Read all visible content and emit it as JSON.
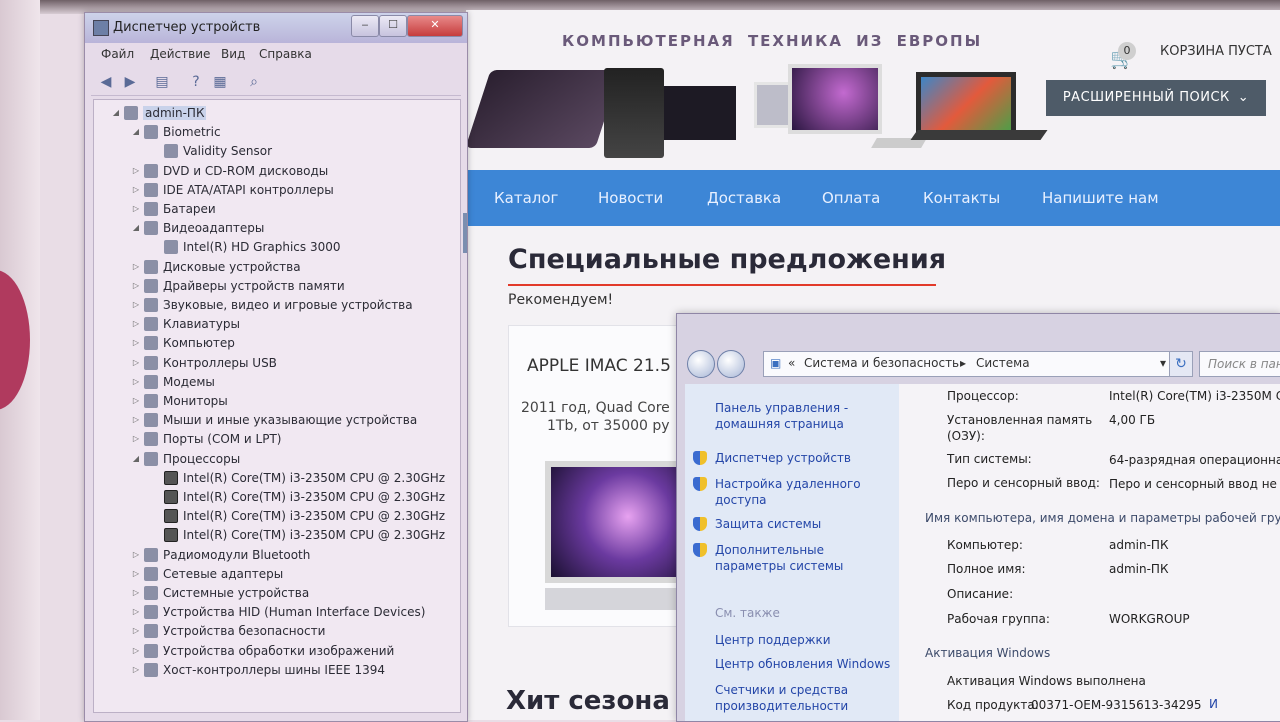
{
  "site": {
    "tagline": "КОМПЬЮТЕРНАЯ ТЕХНИКА ИЗ ЕВРОПЫ",
    "cart_count": "0",
    "cart_label": "КОРЗИНА ПУСТА",
    "advanced_search": "РАСШИРЕННЫЙ ПОИСК",
    "nav": [
      "Каталог",
      "Новости",
      "Доставка",
      "Оплата",
      "Контакты",
      "Напишите нам"
    ],
    "special_title": "Специальные предложения",
    "recommend": "Рекомендуем!",
    "product_name": "APPLE IMAC 21.5",
    "product_desc_line1": "2011 год, Quad Core",
    "product_desc_line2": "1Tb, от 35000 ру",
    "hit_title": "Хит сезона"
  },
  "device_manager": {
    "title": "Диспетчер устройств",
    "window_buttons": [
      "‒",
      "☐",
      "✕"
    ],
    "menu": [
      "Файл",
      "Действие",
      "Вид",
      "Справка"
    ],
    "tree": [
      {
        "label": "admin-ПК",
        "level": 0,
        "expander": "◢"
      },
      {
        "label": "Biometric",
        "level": 1,
        "expander": "◢"
      },
      {
        "label": "Validity Sensor",
        "level": 2,
        "expander": ""
      },
      {
        "label": "DVD и CD-ROM дисководы",
        "level": 1,
        "expander": "▷"
      },
      {
        "label": "IDE ATA/ATAPI контроллеры",
        "level": 1,
        "expander": "▷"
      },
      {
        "label": "Батареи",
        "level": 1,
        "expander": "▷"
      },
      {
        "label": "Видеоадаптеры",
        "level": 1,
        "expander": "◢"
      },
      {
        "label": "Intel(R) HD Graphics 3000",
        "level": 2,
        "expander": ""
      },
      {
        "label": "Дисковые устройства",
        "level": 1,
        "expander": "▷"
      },
      {
        "label": "Драйверы устройств памяти",
        "level": 1,
        "expander": "▷"
      },
      {
        "label": "Звуковые, видео и игровые устройства",
        "level": 1,
        "expander": "▷"
      },
      {
        "label": "Клавиатуры",
        "level": 1,
        "expander": "▷"
      },
      {
        "label": "Компьютер",
        "level": 1,
        "expander": "▷"
      },
      {
        "label": "Контроллеры USB",
        "level": 1,
        "expander": "▷"
      },
      {
        "label": "Модемы",
        "level": 1,
        "expander": "▷"
      },
      {
        "label": "Мониторы",
        "level": 1,
        "expander": "▷"
      },
      {
        "label": "Мыши и иные указывающие устройства",
        "level": 1,
        "expander": "▷"
      },
      {
        "label": "Порты (COM и LPT)",
        "level": 1,
        "expander": "▷"
      },
      {
        "label": "Процессоры",
        "level": 1,
        "expander": "◢"
      },
      {
        "label": "Intel(R) Core(TM) i3-2350M CPU @ 2.30GHz",
        "level": 2,
        "expander": "",
        "cpu": true
      },
      {
        "label": "Intel(R) Core(TM) i3-2350M CPU @ 2.30GHz",
        "level": 2,
        "expander": "",
        "cpu": true
      },
      {
        "label": "Intel(R) Core(TM) i3-2350M CPU @ 2.30GHz",
        "level": 2,
        "expander": "",
        "cpu": true
      },
      {
        "label": "Intel(R) Core(TM) i3-2350M CPU @ 2.30GHz",
        "level": 2,
        "expander": "",
        "cpu": true
      },
      {
        "label": "Радиомодули Bluetooth",
        "level": 1,
        "expander": "▷"
      },
      {
        "label": "Сетевые адаптеры",
        "level": 1,
        "expander": "▷"
      },
      {
        "label": "Системные устройства",
        "level": 1,
        "expander": "▷"
      },
      {
        "label": "Устройства HID (Human Interface Devices)",
        "level": 1,
        "expander": "▷"
      },
      {
        "label": "Устройства безопасности",
        "level": 1,
        "expander": "▷"
      },
      {
        "label": "Устройства обработки изображений",
        "level": 1,
        "expander": "▷"
      },
      {
        "label": "Хост-контроллеры шины IEEE 1394",
        "level": 1,
        "expander": "▷"
      }
    ]
  },
  "control_panel": {
    "breadcrumb_prefix": "«",
    "breadcrumb_1": "Система и безопасность",
    "breadcrumb_sep": "▸",
    "breadcrumb_2": "Система",
    "dropdown_arrow": "▾",
    "refresh": "↻",
    "search_placeholder": "Поиск в пан",
    "left_home": "Панель управления - домашняя страница",
    "left_links": [
      "Диспетчер устройств",
      "Настройка удаленного доступа",
      "Защита системы",
      "Дополнительные параметры системы"
    ],
    "see_also": "См. также",
    "see_also_links": [
      "Центр поддержки",
      "Центр обновления Windows",
      "Счетчики и средства производительности"
    ],
    "system_rows": [
      {
        "label": "Процессор:",
        "value": "Intel(R) Core(TM) i3-2350M CP"
      },
      {
        "label": "Установленная память (ОЗУ):",
        "value": "4,00 ГБ"
      },
      {
        "label": "Тип системы:",
        "value": "64-разрядная операционная"
      },
      {
        "label": "Перо и сенсорный ввод:",
        "value": "Перо и сенсорный ввод не"
      }
    ],
    "name_section": "Имя компьютера, имя домена и параметры рабочей групп",
    "name_rows": [
      {
        "label": "Компьютер:",
        "value": "admin-ПК"
      },
      {
        "label": "Полное имя:",
        "value": "admin-ПК"
      },
      {
        "label": "Описание:",
        "value": ""
      },
      {
        "label": "Рабочая группа:",
        "value": "WORKGROUP"
      }
    ],
    "activation_section": "Активация Windows",
    "activation_status": "Активация Windows выполнена",
    "product_code_label": "Код продукта:",
    "product_code": "00371-OEM-9315613-34295",
    "change_link": "И"
  }
}
